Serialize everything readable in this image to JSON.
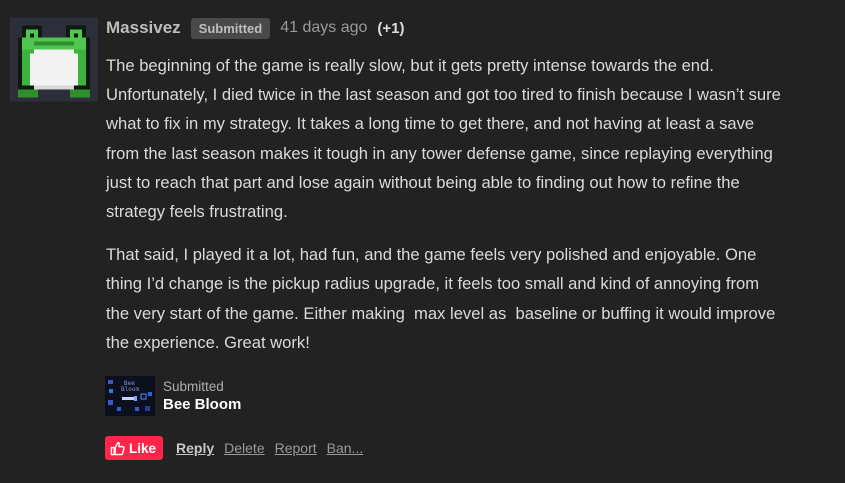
{
  "comment": {
    "author": "Massivez",
    "badge": "Submitted",
    "time": "41 days ago",
    "votes": "(+1)",
    "paragraphs": [
      "The beginning of the game is really slow, but it gets pretty intense towards the end.\nUnfortunately, I died twice in the last season and got too tired to finish because I wasn’t sure\nwhat to fix in my strategy. It takes a long time to get there, and not having at least a save\nfrom the last season makes it tough in any tower defense game, since replaying everything\njust to reach that part and lose again without being able to finding out how to refine the\nstrategy feels frustrating.",
      "That said, I played it a lot, had fun, and the game feels very polished and enjoyable. One\nthing I’d change is the pickup radius upgrade, it feels too small and kind of annoying from\nthe very start of the game. Either making  max level as  baseline or buffing it would improve\nthe experience. Great work!"
    ],
    "avatar_icon": "frog-avatar-icon"
  },
  "game": {
    "status": "Submitted",
    "title": "Bee Bloom",
    "thumb_text_line1": "Bee",
    "thumb_text_line2": "Bloom"
  },
  "actions": {
    "like": "Like",
    "reply": "Reply",
    "delete": "Delete",
    "report": "Report",
    "ban": "Ban..."
  },
  "colors": {
    "background": "#222222",
    "like_red": "#ff2449",
    "badge_bg": "#4a4a4a",
    "frog_green": "#3cb33c"
  }
}
